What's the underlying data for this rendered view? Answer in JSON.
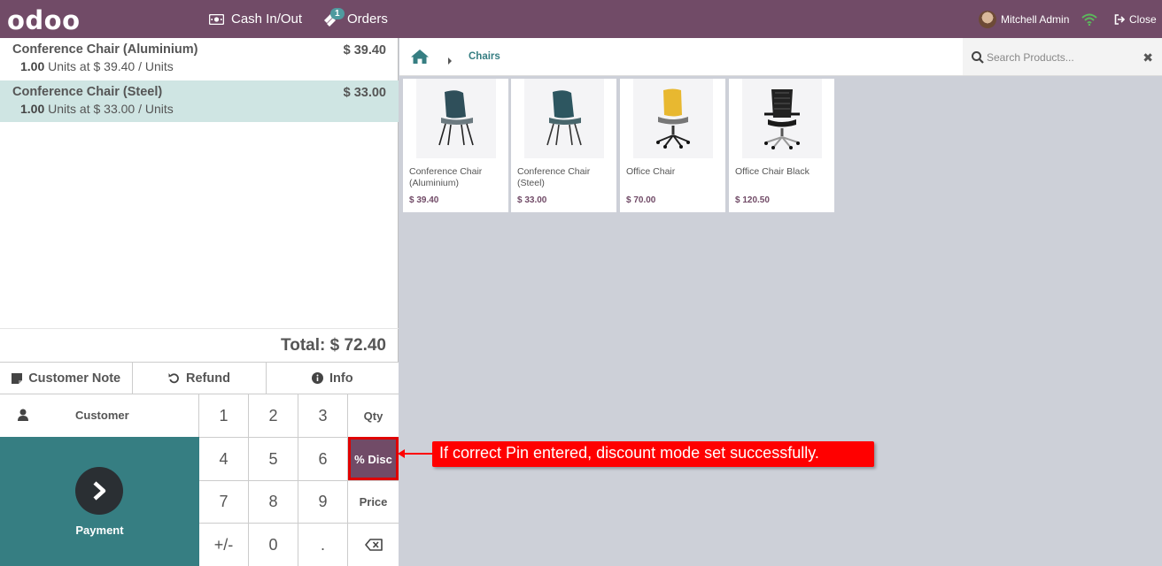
{
  "topbar": {
    "logo": "odoo",
    "cash_label": "Cash In/Out",
    "orders_label": "Orders",
    "orders_badge": "1",
    "user_name": "Mitchell Admin",
    "close_label": "Close"
  },
  "order": {
    "lines": [
      {
        "name": "Conference Chair (Aluminium)",
        "price": "$ 39.40",
        "qty": "1.00",
        "detail": "Units at $ 39.40 / Units"
      },
      {
        "name": "Conference Chair (Steel)",
        "price": "$ 33.00",
        "qty": "1.00",
        "detail": "Units at $ 33.00 / Units"
      }
    ],
    "total": "Total: $ 72.40"
  },
  "controls": {
    "customer_note": "Customer Note",
    "refund": "Refund",
    "info": "Info",
    "customer": "Customer",
    "payment": "Payment"
  },
  "numpad": {
    "keys": [
      "1",
      "2",
      "3",
      "4",
      "5",
      "6",
      "7",
      "8",
      "9",
      "+/-",
      "0",
      "."
    ],
    "qty": "Qty",
    "disc": "% Disc",
    "price": "Price"
  },
  "breadcrumb": {
    "category": "Chairs"
  },
  "search": {
    "placeholder": "Search Products...",
    "value": ""
  },
  "products": [
    {
      "name": "Conference Chair (Aluminium)",
      "price": "$ 39.40"
    },
    {
      "name": "Conference Chair (Steel)",
      "price": "$ 33.00"
    },
    {
      "name": "Office Chair",
      "price": "$ 70.00"
    },
    {
      "name": "Office Chair Black",
      "price": "$ 120.50"
    }
  ],
  "annotation": {
    "text": "If correct Pin entered, discount mode set successfully."
  },
  "colors": {
    "brand": "#714b67",
    "teal": "#367e82",
    "selected_line": "#cfe5e3",
    "callout": "#ff0000"
  }
}
